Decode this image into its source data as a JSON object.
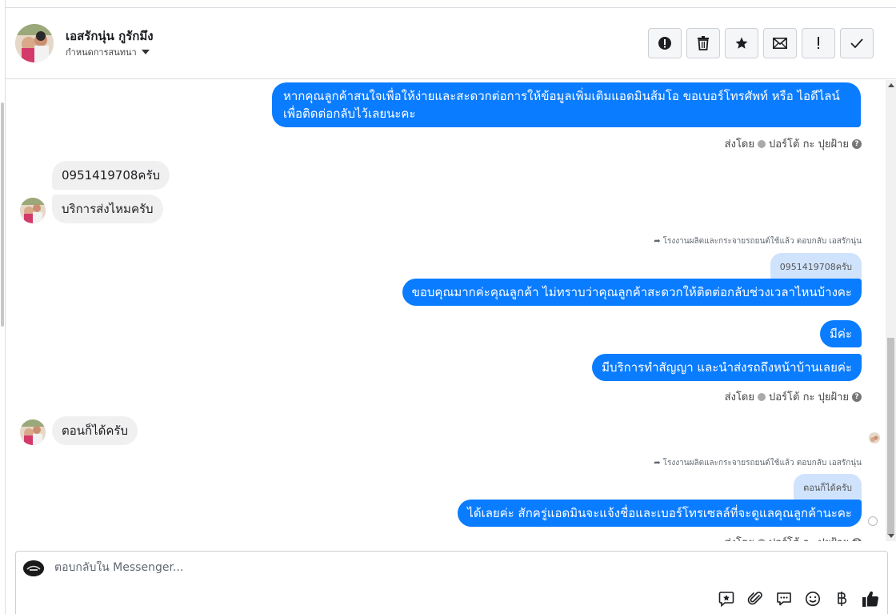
{
  "header": {
    "contact_name": "เอสรักนุ่น กูรักมึง",
    "subtitle": "กำหนดการสนทนา",
    "actions": [
      {
        "name": "report-button",
        "icon": "alert-circle-icon",
        "glyph": "!"
      },
      {
        "name": "delete-button",
        "icon": "trash-icon",
        "glyph": ""
      },
      {
        "name": "star-button",
        "icon": "star-icon",
        "glyph": "★"
      },
      {
        "name": "mark-unread-button",
        "icon": "envelope-icon",
        "glyph": "✉"
      },
      {
        "name": "important-button",
        "icon": "exclamation-icon",
        "glyph": "!"
      },
      {
        "name": "done-button",
        "icon": "check-icon",
        "glyph": "✓"
      }
    ]
  },
  "messages": {
    "out_1_line1": "หากคุณลูกค้าสนใจเพื่อให้ง่ายและสะดวกต่อการให้ข้อมูลเพิ่มเติมแอดมินส้มโอ ขอเบอร์โทรศัพท์ หรือ ไอดีไลน์",
    "out_1_line2": "เพื่อติดต่อกลับไว้เลยนะคะ",
    "sent_by_1": "ส่งโดย",
    "sender_1": "ปอร์โต้ กะ ปุยฝ้าย",
    "in_1": "0951419708ครับ",
    "in_2": "บริการส่งไหมครับ",
    "reply_note_1": "โรงงานผลิตและกระจายรถยนต์ใช้แล้ว ตอบกลับ เอสรักนุ่น",
    "quote_1": "0951419708ครับ",
    "out_2": "ขอบคุณมากค่ะคุณลูกค้า ไม่ทราบว่าคุณลูกค้าสะดวกให้ติดต่อกลับช่วงเวลาไหนบ้างคะ",
    "out_3": "มีค่ะ",
    "out_4": "มีบริการทำสัญญา และนำส่งรถถึงหน้าบ้านเลยค่ะ",
    "sent_by_2": "ส่งโดย",
    "sender_2": "ปอร์โต้ กะ ปุยฝ้าย",
    "in_3": "ตอนก็ได้ครับ",
    "reply_note_2": "โรงงานผลิตและกระจายรถยนต์ใช้แล้ว ตอบกลับ เอสรักนุ่น",
    "quote_2": "ตอนก็ได้ครับ",
    "out_5": "ได้เลยค่ะ สักครู่แอดมินจะแจ้งชื่อและเบอร์โทรเซลล์ที่จะดูแลคุณลูกค้านะคะ",
    "sent_by_3": "ส่งโดย",
    "sender_3": "ปอร์โต้ กะ ปุยฝ้าย"
  },
  "composer": {
    "placeholder": "ตอบกลับใน Messenger...",
    "tools": [
      "saved-reply-icon",
      "attachment-icon",
      "chat-icon",
      "emoji-icon",
      "baht-icon",
      "like-icon"
    ]
  },
  "colors": {
    "outgoing_bubble": "#0a7cff",
    "incoming_bubble": "#f0f0f0",
    "quote_bubble": "#d0e3fd"
  }
}
